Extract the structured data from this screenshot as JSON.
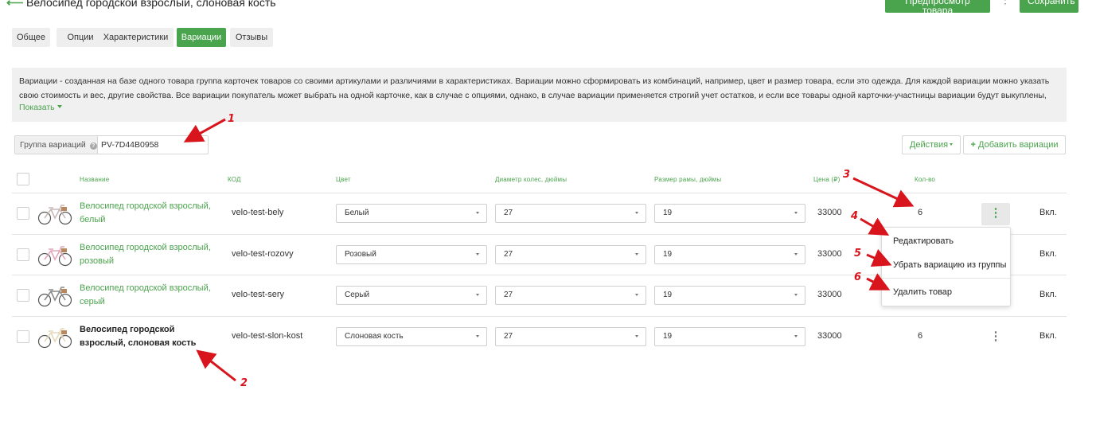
{
  "header": {
    "back_icon": "back-arrow-icon",
    "title": "Велосипед городской взрослый, слоновая кость",
    "preview_label": "Предпросмотр товара",
    "more_icon": "more-vertical-icon",
    "save_label": "Сохранить"
  },
  "tabs": [
    {
      "label": "Общее",
      "active": false
    },
    {
      "label": "Опции",
      "active": false
    },
    {
      "label": "Характеристики",
      "active": false
    },
    {
      "label": "Вариации",
      "active": true
    },
    {
      "label": "Отзывы",
      "active": false
    }
  ],
  "info": {
    "text": "Вариации - созданная на базе одного товара группа карточек товаров со своими артикулами и различиями в характеристиках. Вариации можно сформировать из комбинаций, например, цвет и размер товара, если это одежда. Для каждой вариации можно указать свою стоимость и вес, другие свойства. Все вариации покупатель может выбрать на одной карточке, как в случае с опциями, однако, в случае вариации применяется строгий учет остатков, и если все товары одной карточки-участницы вариации будут выкуплены, система",
    "show_label": "Показать"
  },
  "group": {
    "label": "Группа вариаций",
    "help_icon": "help-icon",
    "value": "PV-7D44B0958"
  },
  "toolbar": {
    "actions_label": "Действия",
    "add_label": "Добавить вариации",
    "add_icon": "plus-icon"
  },
  "table": {
    "columns": {
      "name": "Название",
      "code": "КОД",
      "color": "Цвет",
      "wheel": "Диаметр колес, дюймы",
      "frame": "Размер рамы, дюймы",
      "price": "Цена (₽)",
      "qty": "Кол-во"
    },
    "rows": [
      {
        "name": "Велосипед городской взрослый, белый",
        "code": "velo-test-bely",
        "color": "Белый",
        "wheel": "27",
        "frame": "19",
        "price": "33000",
        "qty": "6",
        "status": "Вкл.",
        "current": false
      },
      {
        "name": "Велосипед городской взрослый, розовый",
        "code": "velo-test-rozovy",
        "color": "Розовый",
        "wheel": "27",
        "frame": "19",
        "price": "33000",
        "qty": "",
        "status": "Вкл.",
        "current": false
      },
      {
        "name": "Велосипед городской взрослый, серый",
        "code": "velo-test-sery",
        "color": "Серый",
        "wheel": "27",
        "frame": "19",
        "price": "33000",
        "qty": "",
        "status": "Вкл.",
        "current": false
      },
      {
        "name": "Велосипед городской взрослый, слоновая кость",
        "code": "velo-test-slon-kost",
        "color": "Слоновая кость",
        "wheel": "27",
        "frame": "19",
        "price": "33000",
        "qty": "6",
        "status": "Вкл.",
        "current": true
      }
    ]
  },
  "row_menu": {
    "items": [
      "Редактировать",
      "Убрать вариацию из группы",
      "Удалить товар"
    ]
  },
  "annotations": [
    "1",
    "2",
    "3",
    "4",
    "5",
    "6"
  ],
  "colors": {
    "accent": "#4aa34d",
    "annotation": "#d8141c"
  }
}
